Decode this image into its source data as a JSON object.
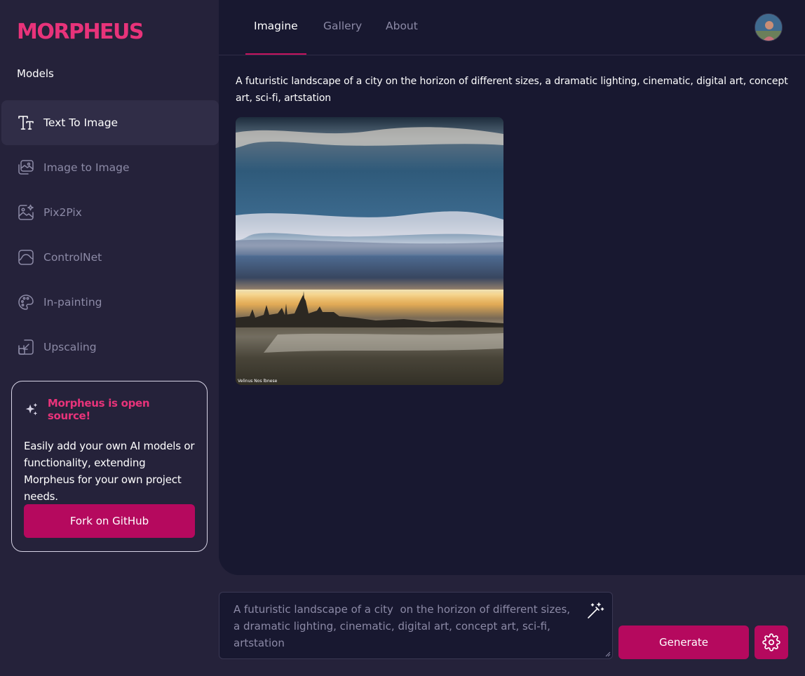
{
  "app": {
    "logo_text": "MORPHEUS",
    "accent_color": "#e8337a",
    "button_color": "#b5095e"
  },
  "sidebar": {
    "section_title": "Models",
    "items": [
      {
        "label": "Text To Image",
        "icon": "text-icon",
        "active": true
      },
      {
        "label": "Image to Image",
        "icon": "image-to-image-icon",
        "active": false
      },
      {
        "label": "Pix2Pix",
        "icon": "image-sparkle-icon",
        "active": false
      },
      {
        "label": "ControlNet",
        "icon": "controlnet-icon",
        "active": false
      },
      {
        "label": "In-painting",
        "icon": "palette-icon",
        "active": false
      },
      {
        "label": "Upscaling",
        "icon": "upscale-icon",
        "active": false
      }
    ]
  },
  "promo": {
    "title": "Morpheus is open source!",
    "body": "Easily add your own AI models or functionality, extending Morpheus for your own project needs.",
    "button_label": "Fork on GitHub",
    "icon": "sparkles-icon"
  },
  "header": {
    "tabs": [
      {
        "label": "Imagine",
        "active": true
      },
      {
        "label": "Gallery",
        "active": false
      },
      {
        "label": "About",
        "active": false
      }
    ],
    "avatar": "user-avatar"
  },
  "result": {
    "prompt": "A futuristic landscape of a city on the horizon of different sizes, a dramatic lighting, cinematic, digital art, concept art, sci-fi, artstation",
    "image_watermark": "Velinus Nos lbnese"
  },
  "composer": {
    "prompt_value": "A futuristic landscape of a city  on the horizon of different sizes, a dramatic lighting, cinematic, digital art, concept art, sci-fi, artstation",
    "generate_label": "Generate",
    "magic_icon": "magic-wand-icon",
    "settings_icon": "gear-icon"
  }
}
